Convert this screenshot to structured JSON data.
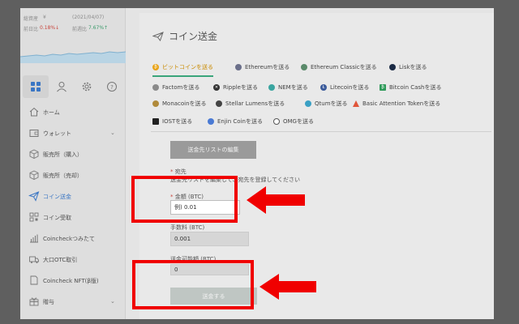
{
  "stats": {
    "total_label": "総資産",
    "total_value": "¥",
    "date": "(2021/04/07)",
    "change_label": "前日比",
    "change_value": "0.18%↓",
    "prev_label": "前週比",
    "prev_value": "7.67%↑"
  },
  "sidebar": {
    "items": [
      {
        "label": "ホーム",
        "icon": "home-icon",
        "has_chevron": false
      },
      {
        "label": "ウォレット",
        "icon": "wallet-icon",
        "has_chevron": true,
        "chevron": "⌄"
      },
      {
        "label": "販売所（購入）",
        "icon": "box-buy-icon",
        "has_chevron": false
      },
      {
        "label": "販売所（売却）",
        "icon": "box-sell-icon",
        "has_chevron": false
      },
      {
        "label": "コイン送金",
        "icon": "send-icon",
        "has_chevron": false,
        "active": true
      },
      {
        "label": "コイン受取",
        "icon": "qr-icon",
        "has_chevron": false
      },
      {
        "label": "Coincheckつみたて",
        "icon": "bar-chart-icon",
        "has_chevron": false
      },
      {
        "label": "大口OTC取引",
        "icon": "truck-icon",
        "has_chevron": false
      },
      {
        "label": "Coincheck NFT(β版)",
        "icon": "document-icon",
        "has_chevron": false
      },
      {
        "label": "贈与",
        "icon": "gift-icon",
        "has_chevron": true,
        "chevron": "⌄"
      }
    ]
  },
  "main": {
    "title": "コイン送金",
    "tabs": [
      {
        "label": "ビットコインを送る",
        "icon": "bitcoin-icon",
        "color": "#e8a317"
      },
      {
        "label": "Ethereumを送る",
        "icon": "ethereum-icon",
        "color": "#6a6f8a"
      },
      {
        "label": "Ethereum Classicを送る",
        "icon": "ethereum-classic-icon",
        "color": "#5a8a6a"
      },
      {
        "label": "Liskを送る",
        "icon": "lisk-icon",
        "color": "#1a2a44"
      },
      {
        "label": "Factomを送る",
        "icon": "factom-icon",
        "color": "#8a8a8a"
      },
      {
        "label": "Rippleを送る",
        "icon": "ripple-icon",
        "color": "#333333"
      },
      {
        "label": "NEMを送る",
        "icon": "nem-icon",
        "color": "#3aa5a0"
      },
      {
        "label": "Litecoinを送る",
        "icon": "litecoin-icon",
        "color": "#3a5a9a"
      },
      {
        "label": "Bitcoin Cashを送る",
        "icon": "bitcoin-cash-icon",
        "color": "#2f9a5a"
      },
      {
        "label": "Monacoinを送る",
        "icon": "monacoin-icon",
        "color": "#b08a3a"
      },
      {
        "label": "Stellar Lumensを送る",
        "icon": "stellar-icon",
        "color": "#444444"
      },
      {
        "label": "Qtumを送る",
        "icon": "qtum-icon",
        "color": "#3aa0c4"
      },
      {
        "label": "Basic Attention Tokenを送る",
        "icon": "bat-icon",
        "color": "#e0553a"
      },
      {
        "label": "IOSTを送る",
        "icon": "iost-icon",
        "color": "#222222"
      },
      {
        "label": "Enjin Coinを送る",
        "icon": "enjin-icon",
        "color": "#4a7ad4"
      },
      {
        "label": "OMGを送る",
        "icon": "omg-icon",
        "color": "#555555"
      }
    ],
    "edit_button": "送金先リストの編集",
    "destination_label": "宛先",
    "destination_hint": "送金先リストを編集して、宛先を登録してください",
    "amount_label": "金額 (BTC)",
    "amount_placeholder": "例) 0.01",
    "fee_label": "手数料 (BTC)",
    "fee_value": "0.001",
    "available_label": "送金可能額 (BTC)",
    "available_value": "0",
    "send_button": "送金する",
    "required_mark": "*"
  },
  "colors": {
    "highlight": "#f00000",
    "active_tab_underline": "#3aa57a",
    "active_nav": "#3a76c4"
  }
}
